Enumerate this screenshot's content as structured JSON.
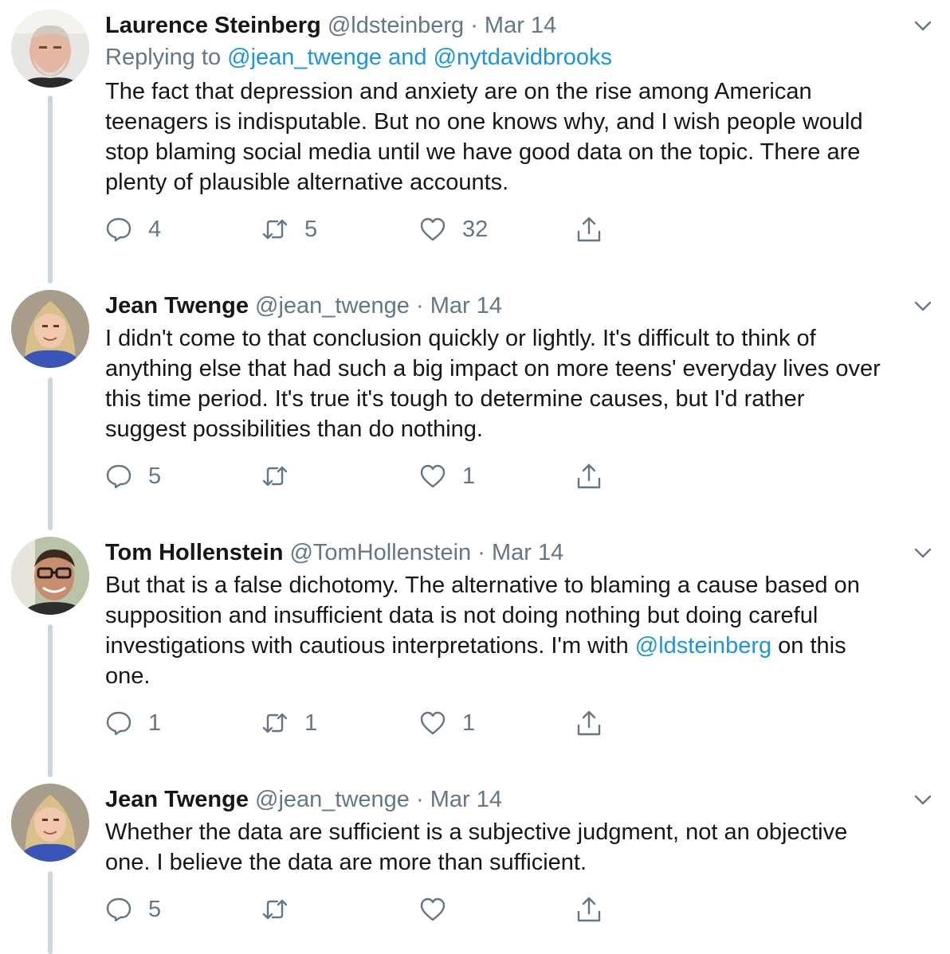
{
  "tweets": [
    {
      "name": "Laurence Steinberg",
      "handle": "@ldsteinberg",
      "separator": "·",
      "date": "Mar 14",
      "replying_prefix": "Replying to",
      "replying_to": "@jean_twenge and @nytdavidbrooks",
      "body_lines": [
        "The fact that depression and anxiety are on the rise among American",
        "teenagers is indisputable.  But no one knows why, and I wish people would",
        "stop blaming social media until we have good data on the topic. There are",
        "plenty of plausible alternative accounts."
      ],
      "replies": "4",
      "retweets": "5",
      "likes": "32"
    },
    {
      "name": "Jean Twenge",
      "handle": "@jean_twenge",
      "separator": "·",
      "date": "Mar 14",
      "body_lines": [
        "I didn't come to that conclusion quickly or lightly. It's difficult to think of",
        "anything else that had such a big impact on more teens' everyday lives over",
        "this time period. It's true it's tough to determine causes, but I'd rather",
        "suggest possibilities than do nothing."
      ],
      "replies": "5",
      "retweets": "",
      "likes": "1"
    },
    {
      "name": "Tom Hollenstein",
      "handle": "@TomHollenstein",
      "separator": "·",
      "date": "Mar 14",
      "body_lines": [
        "But that is a false dichotomy. The alternative to blaming a cause based on",
        "supposition and insufficient data is not doing nothing but doing careful"
      ],
      "body_line3_before": "investigations with cautious interpretations. I'm with ",
      "body_line3_mention": "@ldsteinberg",
      "body_line3_after": " on this",
      "body_line4": "one.",
      "replies": "1",
      "retweets": "1",
      "likes": "1"
    },
    {
      "name": "Jean Twenge",
      "handle": "@jean_twenge",
      "separator": "·",
      "date": "Mar 14",
      "body_lines": [
        "Whether the data are sufficient is a subjective judgment, not an objective",
        "one. I believe the data are more than sufficient."
      ],
      "replies": "5",
      "retweets": "",
      "likes": ""
    }
  ],
  "icons": {
    "reply": "reply-icon",
    "retweet": "retweet-icon",
    "like": "heart-icon",
    "share": "share-icon",
    "more": "chevron-down-icon"
  },
  "colors": {
    "text": "#14171a",
    "muted": "#657786",
    "link": "#1b95e0",
    "thread_line": "#ccd6dd"
  }
}
